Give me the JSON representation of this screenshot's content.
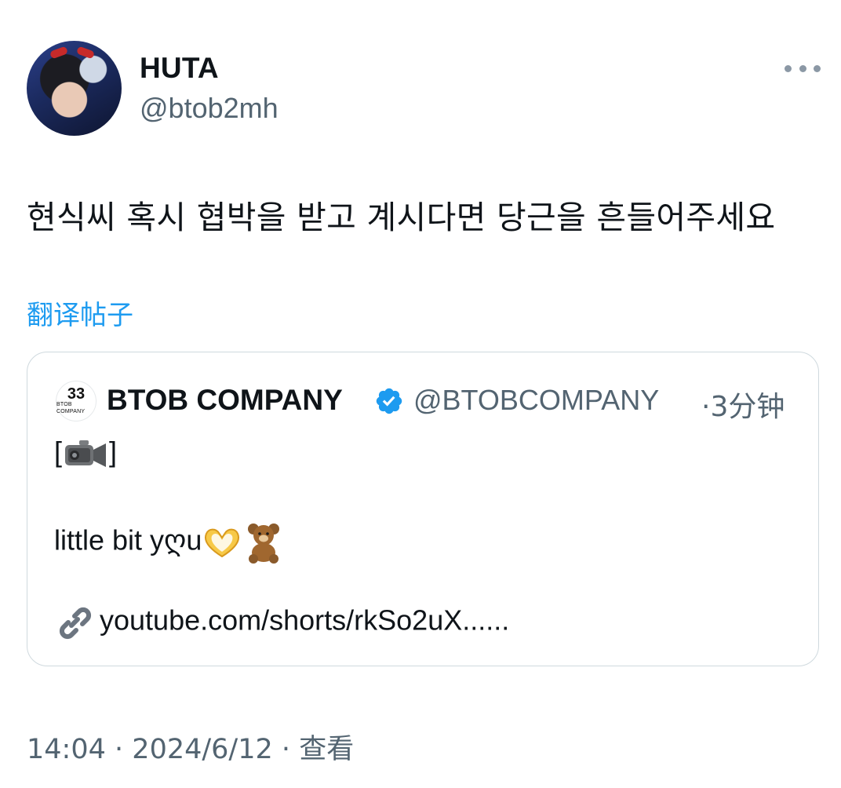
{
  "author": {
    "display_name": "HUTA",
    "handle": "@btob2mh",
    "avatar_icon": "profile-photo"
  },
  "more_icon": "ellipsis-icon",
  "tweet": {
    "text": "현식씨 혹시 협박을 받고 계시다면 당근을 흔들어주세요",
    "translate_label": "翻译帖子"
  },
  "quoted": {
    "avatar_text": "BTOB COMPANY",
    "avatar_mark": "33",
    "display_name": "BTOB COMPANY",
    "verified": true,
    "handle": "@BTOBCOMPANY",
    "separator": "·",
    "time": "3分钟",
    "line1_open": "[",
    "line1_close": "]",
    "line2": "little bit yღu",
    "link": "youtube.com/shorts/rkSo2uX......"
  },
  "meta": {
    "time": "14:04",
    "sep1": "·",
    "date": "2024/6/12",
    "sep2": "·",
    "views_label": "查看"
  },
  "colors": {
    "link_blue": "#1d9bf0",
    "secondary_text": "#536471",
    "border": "#cfd9de"
  }
}
